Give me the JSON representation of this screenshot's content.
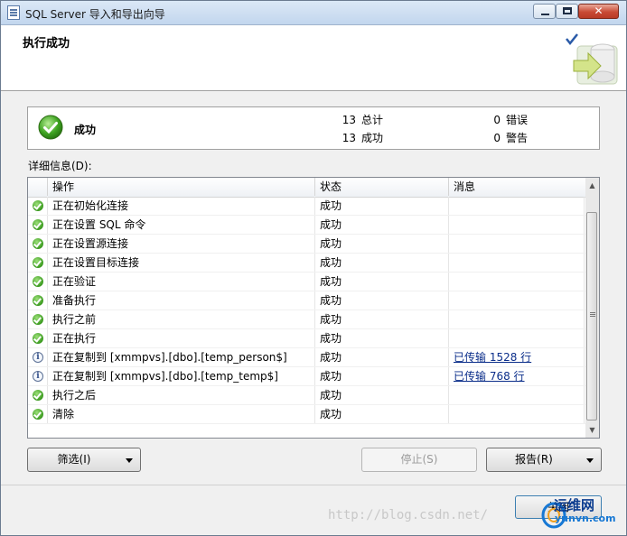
{
  "window": {
    "title": "SQL Server 导入和导出向导"
  },
  "header": {
    "title": "执行成功"
  },
  "summary": {
    "status": "成功",
    "total_count": "13",
    "total_label": "总计",
    "success_count": "13",
    "success_label": "成功",
    "error_count": "0",
    "error_label": "错误",
    "warning_count": "0",
    "warning_label": "警告"
  },
  "details": {
    "label": "详细信息(D):",
    "columns": {
      "action": "操作",
      "status": "状态",
      "message": "消息"
    },
    "rows": [
      {
        "icon": "success-icon",
        "action": "正在初始化连接",
        "status": "成功",
        "message": ""
      },
      {
        "icon": "success-icon",
        "action": "正在设置 SQL 命令",
        "status": "成功",
        "message": ""
      },
      {
        "icon": "success-icon",
        "action": "正在设置源连接",
        "status": "成功",
        "message": ""
      },
      {
        "icon": "success-icon",
        "action": "正在设置目标连接",
        "status": "成功",
        "message": ""
      },
      {
        "icon": "success-icon",
        "action": "正在验证",
        "status": "成功",
        "message": ""
      },
      {
        "icon": "success-icon",
        "action": "准备执行",
        "status": "成功",
        "message": ""
      },
      {
        "icon": "success-icon",
        "action": "执行之前",
        "status": "成功",
        "message": ""
      },
      {
        "icon": "success-icon",
        "action": "正在执行",
        "status": "成功",
        "message": ""
      },
      {
        "icon": "info-icon",
        "action": "正在复制到 [xmmpvs].[dbo].[temp_person$]",
        "status": "成功",
        "message": "已传输 1528 行"
      },
      {
        "icon": "info-icon",
        "action": "正在复制到 [xmmpvs].[dbo].[temp_temp$]",
        "status": "成功",
        "message": "已传输 768 行"
      },
      {
        "icon": "success-icon",
        "action": "执行之后",
        "status": "成功",
        "message": ""
      },
      {
        "icon": "success-icon",
        "action": "清除",
        "status": "成功",
        "message": ""
      }
    ]
  },
  "buttons": {
    "filter": "筛选(I)",
    "stop": "停止(S)",
    "report": "报告(R)",
    "close": "关闭"
  },
  "watermark": {
    "url": "http://blog.csdn.net/",
    "brand": "运维网",
    "brand_sub": "yunvn.com"
  },
  "colors": {
    "success": "#3a9a1e",
    "link": "#0b2e8a",
    "accent": "#3c7fb1"
  }
}
